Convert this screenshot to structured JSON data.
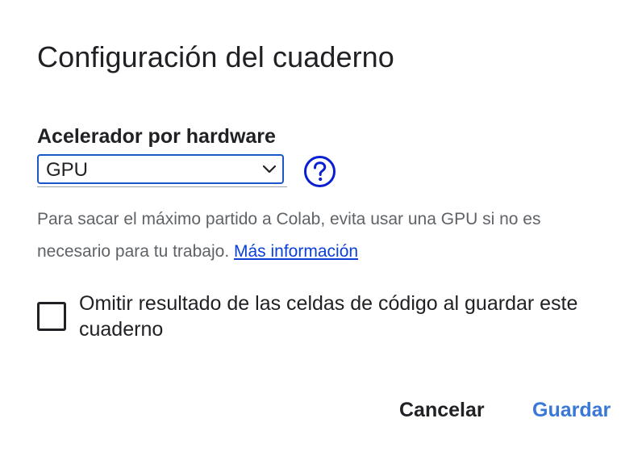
{
  "dialog": {
    "title": "Configuración del cuaderno",
    "accelerator": {
      "label": "Acelerador por hardware",
      "selected_value": "GPU",
      "help_icon": "question-circle-icon"
    },
    "hint": {
      "text": "Para sacar el máximo partido a Colab, evita usar una GPU si no es necesario para tu trabajo.",
      "link_text": "Más información"
    },
    "omit_output": {
      "label": "Omitir resultado de las celdas de código al guardar este cuaderno",
      "checked": false
    },
    "buttons": {
      "cancel": "Cancelar",
      "save": "Guardar"
    },
    "colors": {
      "accent": "#1a56c9",
      "save_button": "#3a78d8",
      "link": "#0b3fd6",
      "help_icon": "#0a1fd1"
    }
  }
}
